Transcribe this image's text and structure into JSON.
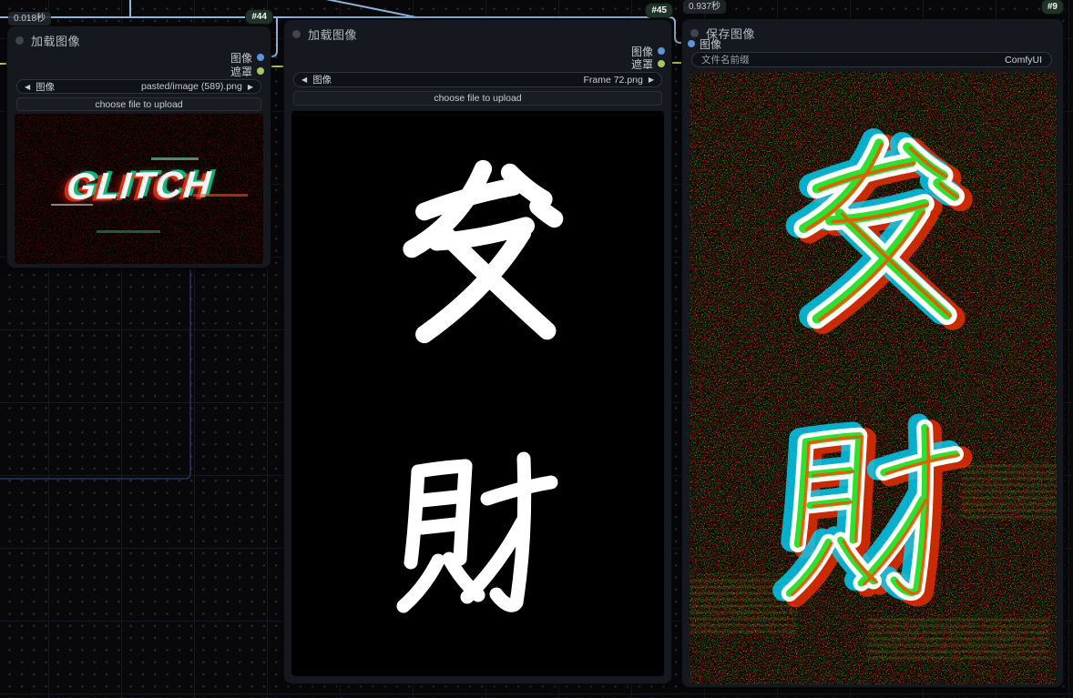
{
  "app": "ComfyUI node graph",
  "colors": {
    "image_slot": "#5e93d8",
    "mask_slot": "#a8c763",
    "link_wire": "#8fb3d9",
    "node_bg": "#15181e",
    "badge_green_bg": "#1f3328"
  },
  "icons": {
    "left_arrow": "◀",
    "right_arrow": "▶"
  },
  "nodes": [
    {
      "id": "#44",
      "duration": "0.018秒",
      "title": "加载图像",
      "outputs": [
        {
          "label": "图像",
          "type": "image"
        },
        {
          "label": "遮罩",
          "type": "mask"
        }
      ],
      "widgets": {
        "image_combo": {
          "label": "图像",
          "value": "pasted/image (589).png"
        },
        "upload_button": "choose file to upload"
      },
      "preview": {
        "kind": "glitch-text-image",
        "text": "GLITCH"
      }
    },
    {
      "id": "#45",
      "title": "加载图像",
      "outputs": [
        {
          "label": "图像",
          "type": "image"
        },
        {
          "label": "遮罩",
          "type": "mask"
        }
      ],
      "widgets": {
        "image_combo": {
          "label": "图像",
          "value": "Frame 72.png"
        },
        "upload_button": "choose file to upload"
      },
      "preview": {
        "kind": "calligraphy-image",
        "characters": "发财",
        "style": "white brush strokes on black"
      }
    },
    {
      "id": "#9",
      "duration": "0.937秒",
      "title": "保存图像",
      "inputs": [
        {
          "label": "图像",
          "type": "image"
        }
      ],
      "widgets": {
        "filename_prefix": {
          "label": "文件名前缀",
          "value": "ComfyUI"
        }
      },
      "preview": {
        "kind": "glitch-calligraphy-image",
        "characters": "发财",
        "style": "RGB-split neon glitch on noisy black"
      }
    }
  ]
}
